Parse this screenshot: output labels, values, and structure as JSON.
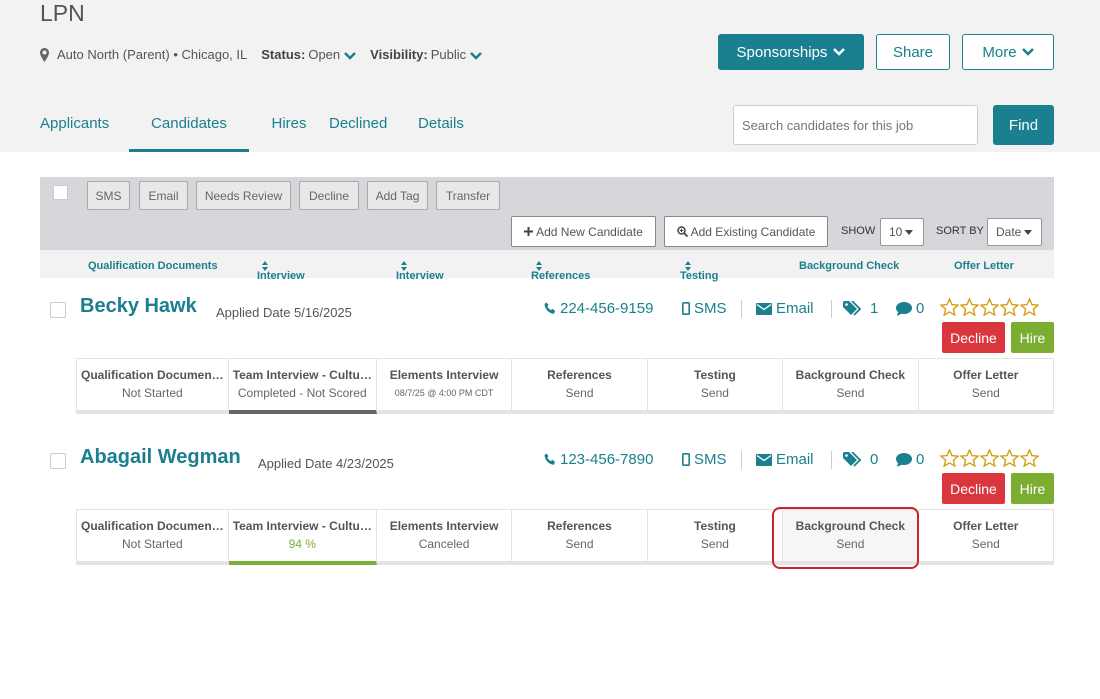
{
  "job": {
    "title": "LPN",
    "location": "Auto North (Parent) • Chicago, IL",
    "status_label": "Status:",
    "status_value": "Open",
    "visibility_label": "Visibility:",
    "visibility_value": "Public"
  },
  "header_buttons": {
    "sponsorships": "Sponsorships",
    "share": "Share",
    "more": "More"
  },
  "tabs": [
    "Applicants",
    "Candidates",
    "Hires",
    "Declined",
    "Details"
  ],
  "active_tab": "Candidates",
  "search": {
    "placeholder": "Search candidates for this job",
    "button": "Find"
  },
  "toolbar": {
    "actions": [
      "SMS",
      "Email",
      "Needs Review",
      "Decline",
      "Add Tag",
      "Transfer"
    ],
    "add_new": "Add New Candidate",
    "add_existing": "Add Existing Candidate",
    "show_label": "SHOW",
    "show_value": "10",
    "sort_label": "SORT BY",
    "sort_value": "Date"
  },
  "columns": [
    "Qualification Documents",
    "Interview",
    "Interview",
    "References",
    "Testing",
    "Background Check",
    "Offer Letter"
  ],
  "candidates": [
    {
      "name": "Becky Hawk",
      "applied": "Applied Date 5/16/2025",
      "phone": "224-456-9159",
      "sms": "SMS",
      "email": "Email",
      "tags": "1",
      "comments": "0",
      "decline": "Decline",
      "hire": "Hire",
      "steps": [
        {
          "label": "Qualification Documen…",
          "value": "Not Started"
        },
        {
          "label": "Team Interview - Cultu…",
          "value": "Completed - Not Scored"
        },
        {
          "label": "Elements Interview",
          "value": "08/7/25 @ 4:00 PM CDT"
        },
        {
          "label": "References",
          "value": "Send"
        },
        {
          "label": "Testing",
          "value": "Send"
        },
        {
          "label": "Background Check",
          "value": "Send"
        },
        {
          "label": "Offer Letter",
          "value": "Send"
        }
      ]
    },
    {
      "name": "Abagail Wegman",
      "applied": "Applied Date 4/23/2025",
      "phone": "123-456-7890",
      "sms": "SMS",
      "email": "Email",
      "tags": "0",
      "comments": "0",
      "decline": "Decline",
      "hire": "Hire",
      "steps": [
        {
          "label": "Qualification Documen…",
          "value": "Not Started"
        },
        {
          "label": "Team Interview - Cultu…",
          "value": "94 %"
        },
        {
          "label": "Elements Interview",
          "value": "Canceled"
        },
        {
          "label": "References",
          "value": "Send"
        },
        {
          "label": "Testing",
          "value": "Send"
        },
        {
          "label": "Background Check",
          "value": "Send"
        },
        {
          "label": "Offer Letter",
          "value": "Send"
        }
      ]
    }
  ],
  "colors": {
    "teal": "#1a7f8e",
    "decline": "#d9363e",
    "hire": "#7aad30",
    "highlight": "#c9242b"
  }
}
